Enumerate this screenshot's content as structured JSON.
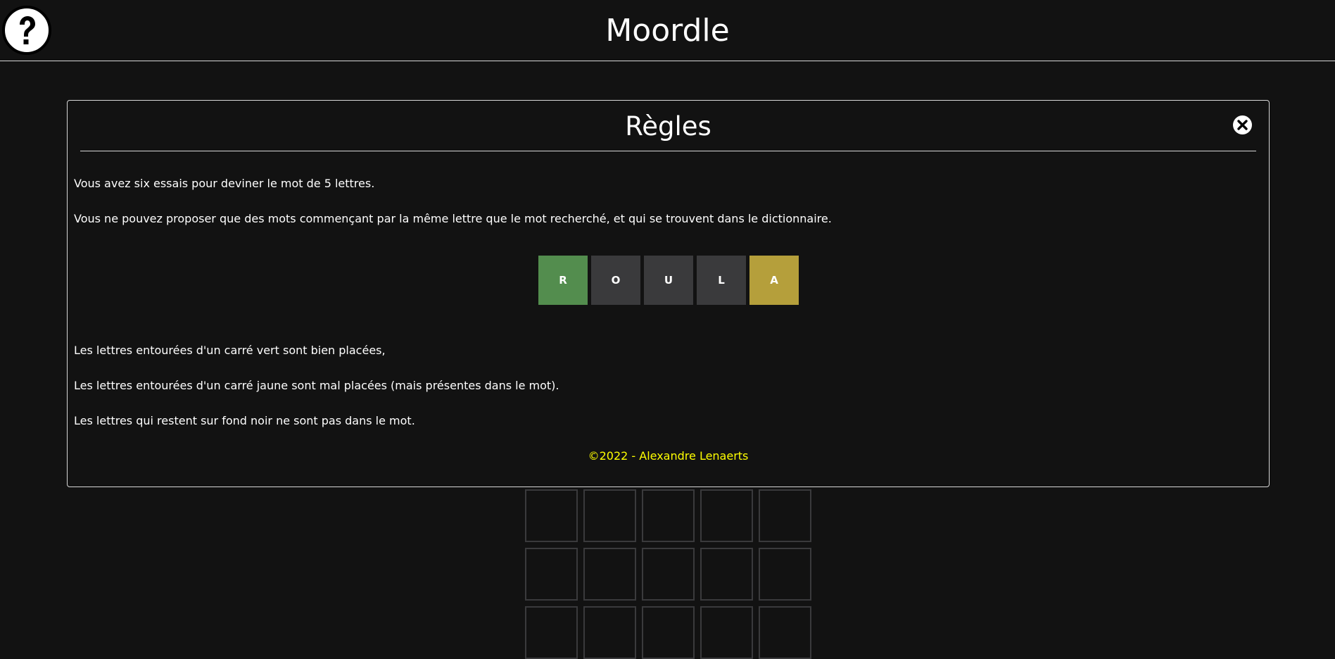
{
  "header": {
    "title": "Moordle",
    "help_icon": "question-mark-icon"
  },
  "modal": {
    "title": "Règles",
    "close_icon": "close-icon",
    "paragraphs": {
      "p1": "Vous avez six essais pour deviner le mot de 5 lettres.",
      "p2": "Vous ne pouvez proposer que des mots commençant par la même lettre que le mot recherché, et qui se trouvent dans le dictionnaire.",
      "p3": "Les lettres entourées d'un carré vert sont bien placées,",
      "p4": "Les lettres entourées d'un carré jaune sont mal placées (mais présentes dans le mot).",
      "p5": "Les lettres qui restent sur fond noir ne sont pas dans le mot."
    },
    "example": [
      {
        "letter": "R",
        "state": "correct",
        "color": "#538d4e"
      },
      {
        "letter": "O",
        "state": "absent",
        "color": "#3a3a3c"
      },
      {
        "letter": "U",
        "state": "absent",
        "color": "#3a3a3c"
      },
      {
        "letter": "L",
        "state": "absent",
        "color": "#3a3a3c"
      },
      {
        "letter": "A",
        "state": "present",
        "color": "#b59f3b"
      }
    ],
    "footer": "©2022 - Alexandre Lenaerts",
    "footer_color": "#ffff00"
  },
  "board": {
    "rows": 3,
    "cols": 5,
    "border_color": "#3a3a3c"
  }
}
